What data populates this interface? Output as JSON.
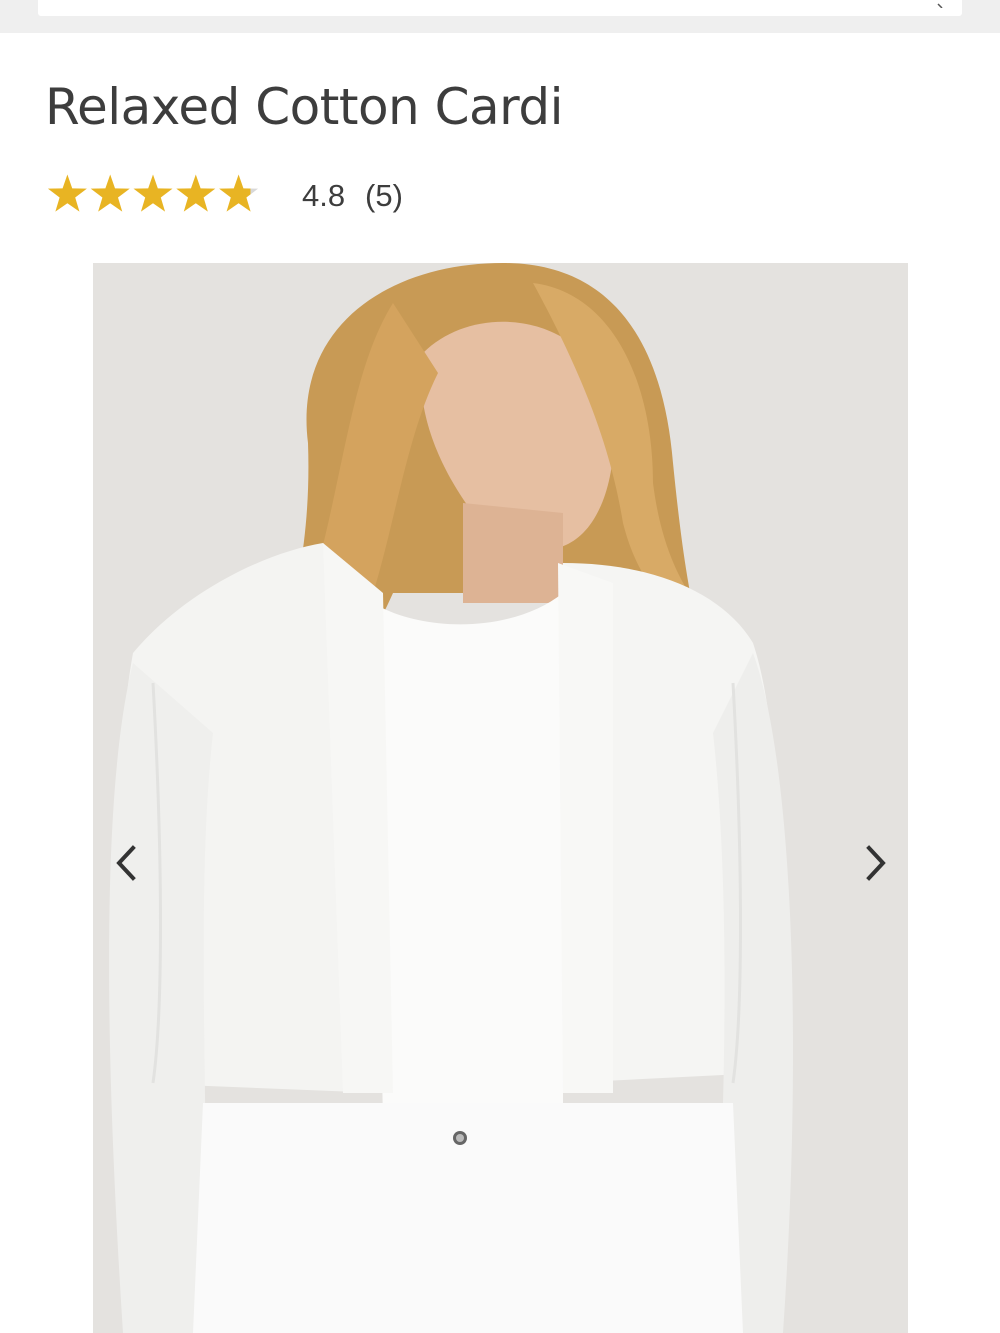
{
  "product": {
    "title": "Relaxed Cotton Cardi",
    "rating": {
      "value": "4.8",
      "count": "(5)",
      "stars_filled": 4.8,
      "stars_total": 5,
      "star_color": "#e8b423"
    }
  },
  "carousel": {
    "image_alt": "Woman wearing white relaxed cotton cardigan over white top and white jeans",
    "prev_icon": "chevron-left-icon",
    "next_icon": "chevron-right-icon"
  },
  "search": {
    "icon": "search-icon"
  }
}
